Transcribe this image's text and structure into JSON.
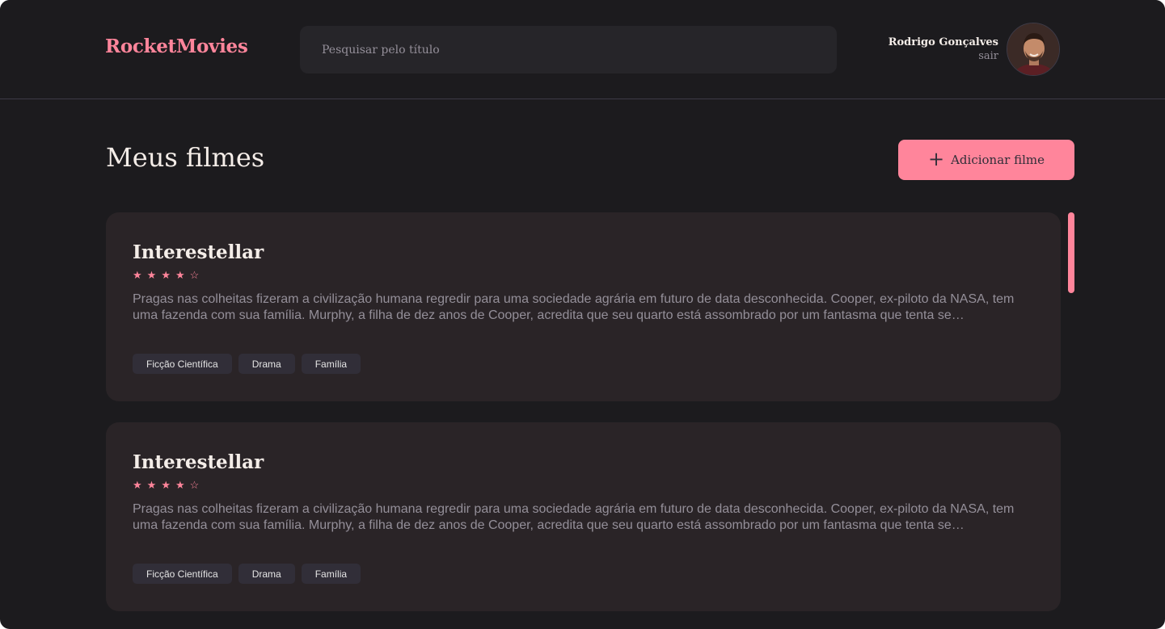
{
  "header": {
    "brand": "RocketMovies",
    "search_placeholder": "Pesquisar pelo título",
    "user_name": "Rodrigo Gonçalves",
    "logout_label": "sair"
  },
  "main": {
    "title": "Meus filmes",
    "add_button_label": "Adicionar filme",
    "movies": [
      {
        "title": "Interestellar",
        "rating": 4,
        "rating_max": 5,
        "stars": [
          "★",
          "★",
          "★",
          "★",
          "☆"
        ],
        "description": "Pragas nas colheitas fizeram a civilização humana regredir para uma sociedade agrária em futuro de data desconhecida. Cooper, ex-piloto da NASA, tem uma fazenda com sua família. Murphy, a filha de dez anos de Cooper, acredita que seu quarto está assombrado por um fantasma que tenta se…",
        "tags": [
          "Ficção Científica",
          "Drama",
          "Família"
        ]
      },
      {
        "title": "Interestellar",
        "rating": 4,
        "rating_max": 5,
        "stars": [
          "★",
          "★",
          "★",
          "★",
          "☆"
        ],
        "description": "Pragas nas colheitas fizeram a civilização humana regredir para uma sociedade agrária em futuro de data desconhecida. Cooper, ex-piloto da NASA, tem uma fazenda com sua família. Murphy, a filha de dez anos de Cooper, acredita que seu quarto está assombrado por um fantasma que tenta se…",
        "tags": [
          "Ficção Científica",
          "Drama",
          "Família"
        ]
      }
    ]
  },
  "colors": {
    "background": "#1c1b1e",
    "accent": "#ff859b",
    "card": "#2a2427",
    "tag": "#312e38",
    "muted_text": "#948f99"
  },
  "icons": {
    "add": "plus-icon",
    "star_filled": "star-filled-icon",
    "star_empty": "star-empty-icon"
  }
}
